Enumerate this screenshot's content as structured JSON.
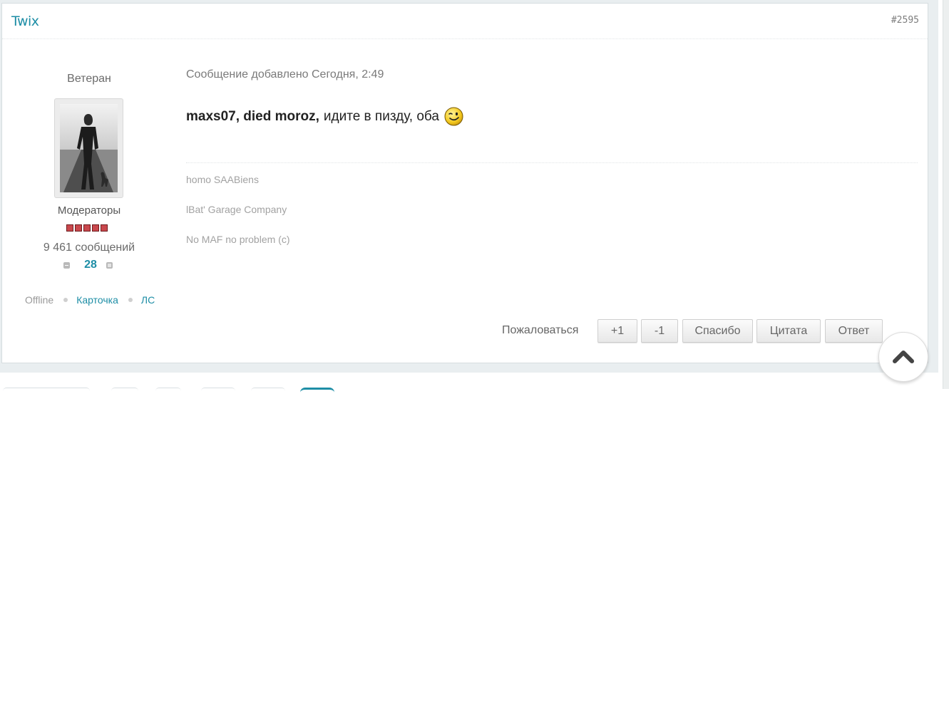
{
  "post": {
    "author": "Twix",
    "number": "#2595",
    "rank": "Ветеран",
    "group": "Модераторы",
    "pips_count": 5,
    "posts_count": "9 461 сообщений",
    "reputation": "28",
    "status": "Offline",
    "profile_link": "Карточка",
    "pm_link": "ЛС",
    "meta": "Сообщение добавлено Сегодня, 2:49",
    "message": {
      "mentions": "maxs07, died moroz,",
      "text": "идите в пизду, оба",
      "smiley": "wink-smiley-icon"
    },
    "signature": [
      "homo SAABiens",
      "lBat' Garage Company",
      "No MAF no problem (c)"
    ]
  },
  "actions": {
    "complain": "Пожаловаться",
    "plus": "+1",
    "minus": "-1",
    "thanks": "Спасибо",
    "quote": "Цитата",
    "reply": "Ответ"
  },
  "colors": {
    "accent": "#1e8ea6",
    "pip": "#c9484d",
    "page_bg": "#e9eef0"
  }
}
